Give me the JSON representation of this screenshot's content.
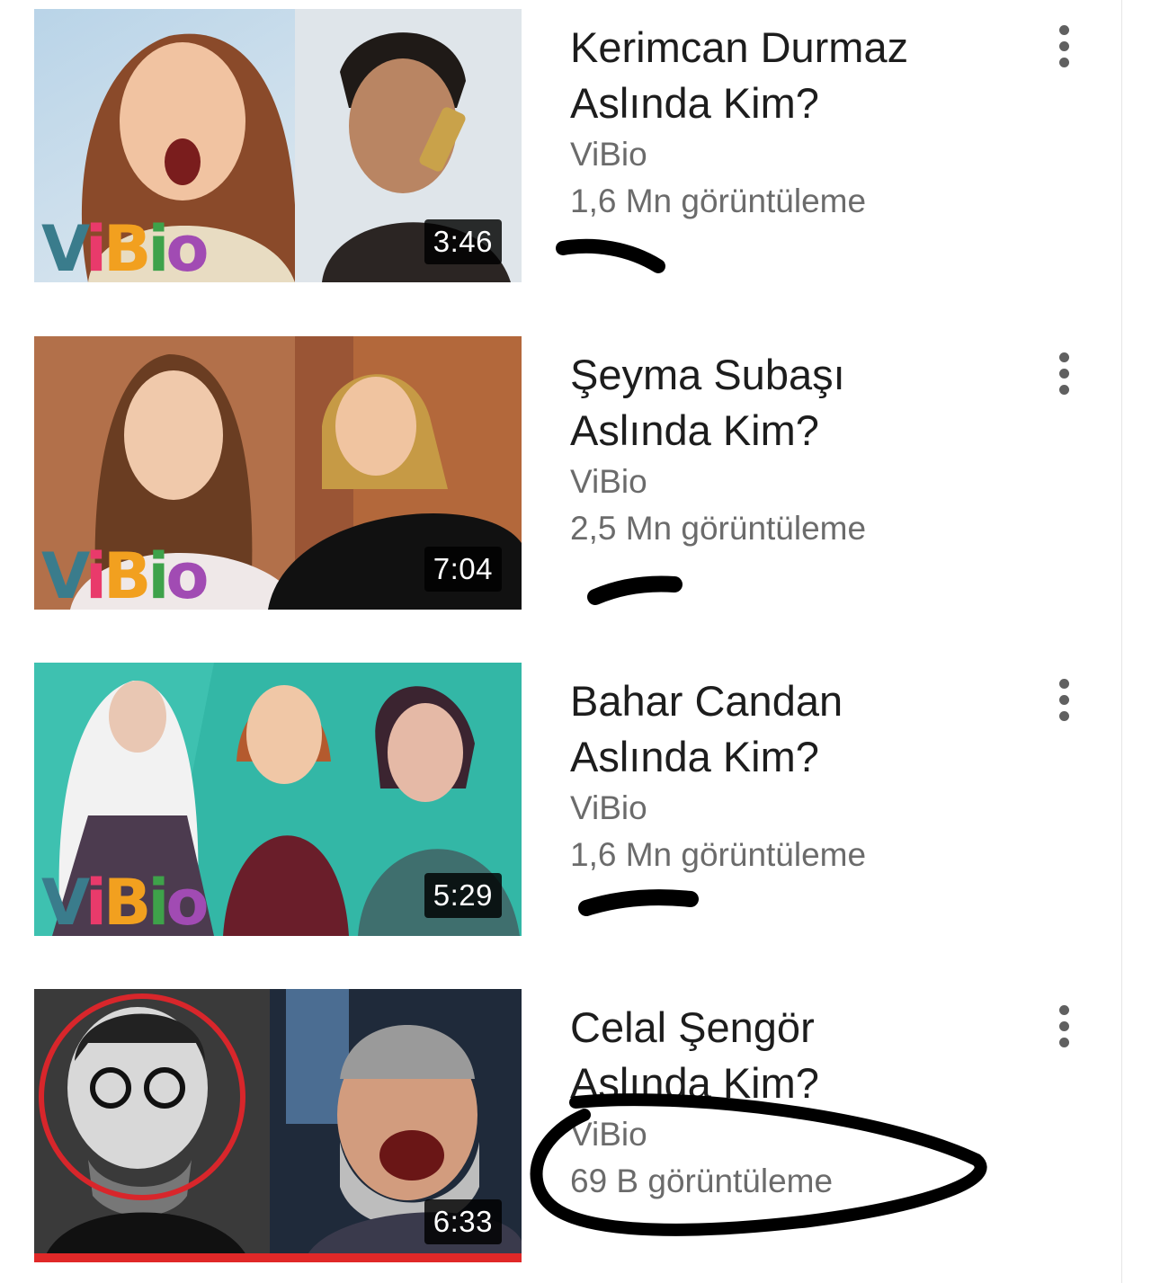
{
  "videos": [
    {
      "title_line1": "Kerimcan Durmaz",
      "title_line2": "Aslında Kim?",
      "channel": "ViBio",
      "views": "1,6 Mn görüntüleme",
      "duration": "3:46"
    },
    {
      "title_line1": "Şeyma Subaşı",
      "title_line2": "Aslında Kim?",
      "channel": "ViBio",
      "views": "2,5 Mn görüntüleme",
      "duration": "7:04"
    },
    {
      "title_line1": "Bahar Candan",
      "title_line2": "Aslında Kim?",
      "channel": "ViBio",
      "views": "1,6 Mn görüntüleme",
      "duration": "5:29"
    },
    {
      "title_line1": "Celal Şengör",
      "title_line2": "Aslında Kim?",
      "channel": "ViBio",
      "views": "69 B görüntüleme",
      "duration": "6:33"
    }
  ],
  "thumbnail_logo": [
    "V",
    "i",
    "B",
    "i",
    "o"
  ],
  "icons": {
    "menu": "more-vert-icon"
  },
  "colors": {
    "title_text": "#1d1d1d",
    "meta_text": "#6b6b6b",
    "duration_badge": "#000000",
    "watched_progress": "#e02828",
    "annotation_ink": "#000000"
  }
}
